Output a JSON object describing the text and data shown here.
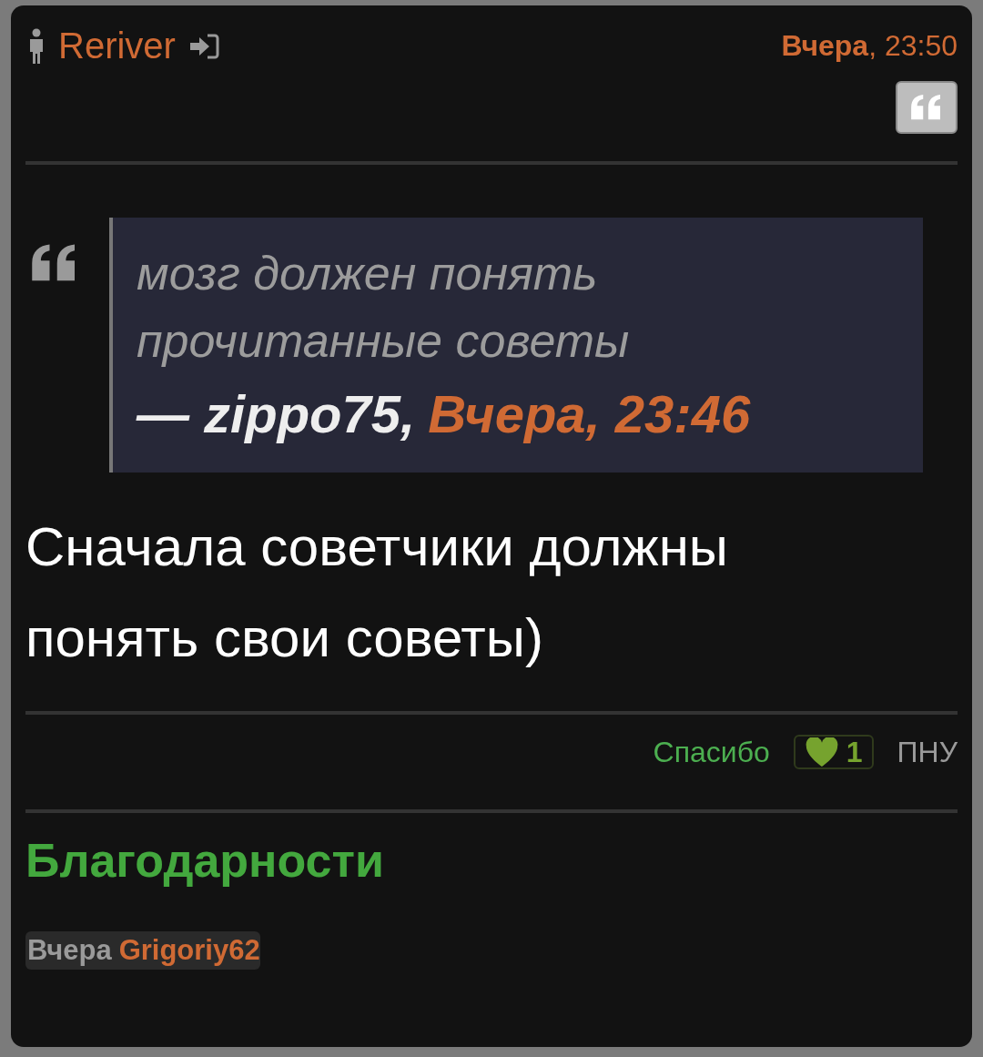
{
  "post": {
    "author": "Reriver",
    "time": "**Вчера**, 23:50",
    "quote": {
      "lines": [
        "мозг должен понять",
        "прочитанные советы"
      ],
      "author": "— zippo75,",
      "date": "Вчера, 23:46"
    },
    "message": {
      "lines": [
        "Сначала советчики должны",
        "понять свои советы)"
      ]
    },
    "actions": {
      "thanks_label": "Спасибо",
      "likes": "1",
      "report_label": "ПНУ"
    },
    "thanks": {
      "title": "Благодарности",
      "items": [
        {
          "when": "Вчера",
          "user": "Grigoriy62"
        }
      ]
    }
  }
}
